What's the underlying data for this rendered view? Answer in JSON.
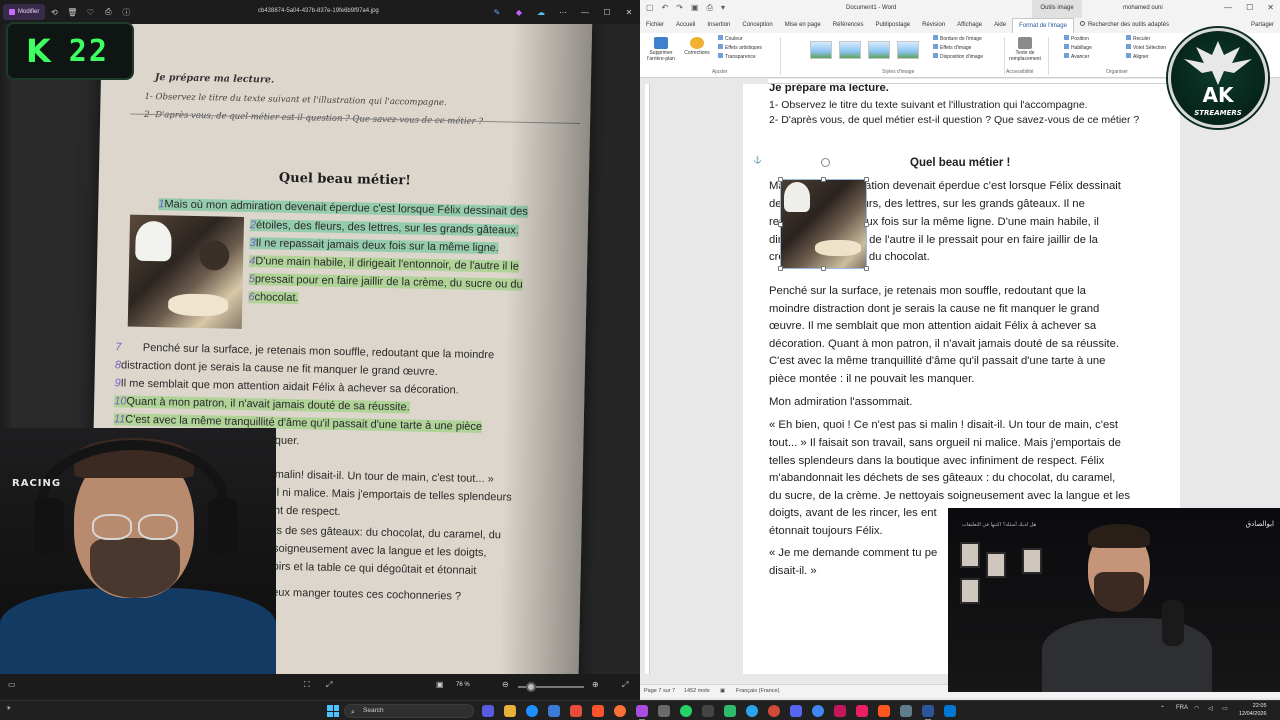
{
  "viewer": {
    "modifier_label": "Modifier",
    "file_name": "cb438874-5a04-437b-837e-19fe6b9f97a4.jpg",
    "zoom": "76 %"
  },
  "overlay": {
    "k_letter": "K",
    "k_number": "22"
  },
  "book_photo": {
    "prepare": "Je prépare ma lecture.",
    "q1": "1- Observez le titre du texte suivant et l'illustration qui l'accompagne.",
    "q2": "2- D'après vous, de quel métier est-il question ? Que savez-vous de ce métier ?",
    "title": "Quel beau métier!",
    "lines": [
      "Mais où mon admiration devenait éperdue c'est lorsque Félix dessinait des",
      "étoiles, des fleurs, des lettres, sur les grands gâteaux.",
      "Il ne repassait jamais deux fois sur la même ligne.",
      "D'une main habile, il dirigeait l'entonnoir, de l'autre il le",
      "pressait pour en faire jaillir de la crème, du sucre ou du",
      "chocolat.",
      "Penché sur la surface, je retenais mon souffle, redoutant que la moindre",
      "distraction dont je serais la cause ne fit manquer le grand œuvre.",
      "Il me semblait que mon attention aidait Félix à achever sa décoration.",
      "Quant à mon patron, il n'avait jamais douté de sa réussite.",
      "C'est avec la même tranquillité d'âme qu'il passait d'une tarte  à une pièce",
      "manquer.",
      "malin! disait-il. Un tour de main, c'est tout... »",
      "il ni malice. Mais j'emportais de telles splendeurs",
      "nt de respect.",
      "ts de ses gâteaux: du chocolat, du caramel, du",
      "soigneusement avec la langue et les doigts,",
      "oirs et la table ce qui dégoûtait et étonnait",
      "eux manger toutes ces cochonneries ?"
    ],
    "numbers": [
      "1",
      "2",
      "3",
      "4",
      "5",
      "6",
      "7",
      "8",
      "9",
      "10",
      "11"
    ]
  },
  "webcam_left": {
    "shirt_text": "RACING"
  },
  "word": {
    "doc_title": "Document1 - Word",
    "context_tab": "Outils image",
    "user": "mohamed ouni",
    "tabs": [
      "Fichier",
      "Accueil",
      "Insertion",
      "Conception",
      "Mise en page",
      "Références",
      "Publipostage",
      "Révision",
      "Affichage",
      "Aide",
      "Format de l'image",
      "Rechercher des outils adaptés",
      "Partager"
    ],
    "active_tab": "Format de l'image",
    "ribbon": {
      "remove_bg": "Supprimer l'arrière-plan",
      "corrections": "Corrections",
      "couleur": "Couleur",
      "effets_artistiques": "Effets artistiques",
      "transparence": "Transparence",
      "group_ajuster": "Ajuster",
      "group_styles": "Styles d'image",
      "bordure": "Bordure de l'image",
      "effets": "Effets d'image",
      "disposition": "Disposition d'image",
      "texte_rempl": "Texte de remplacement",
      "group_access": "Accessibilité",
      "position": "Position",
      "habillage": "Habillage",
      "avancer": "Avancer",
      "reculer": "Reculer",
      "volet": "Volet Sélection",
      "aligner": "Aligner",
      "group_organiser": "Organiser"
    },
    "page": {
      "prepare": "Je prépare ma lecture.",
      "q1": "1- Observez le titre du texte suivant et l'illustration qui l'accompagne.",
      "q2": "2- D'après vous, de quel métier est-il question ? Que savez-vous de ce métier ?",
      "title": "Quel beau métier !",
      "para1": [
        "Mais où mon admiration devenait éperdue c'est lorsque Félix dessinait",
        "des étoiles, des fleurs, des lettres, sur les grands gâteaux. Il ne",
        "repassait jamais deux fois sur la même ligne. D'une main habile, il",
        "dirigeait l'entonnoir, de l'autre il le pressait pour en faire jaillir de la",
        "crème, du sucre ou du chocolat."
      ],
      "para2": [
        "Penché sur la surface, je retenais mon souffle, redoutant que la",
        "moindre distraction dont je serais la cause ne fit manquer le grand",
        "œuvre. Il me semblait que mon attention aidait Félix à achever sa",
        "décoration. Quant à mon patron, il n'avait jamais douté de sa réussite.",
        "C'est avec la même tranquillité d'âme qu'il passait d'une tarte à une",
        "pièce montée : il ne pouvait les manquer."
      ],
      "para3": "Mon admiration l'assommait.",
      "para4": [
        "« Eh bien, quoi ! Ce n'est pas si malin ! disait-il. Un tour de main, c'est",
        "tout... » Il faisait son travail, sans orgueil ni malice. Mais j'emportais de",
        "telles splendeurs dans la boutique avec infiniment de respect. Félix",
        "m'abandonnait les déchets de ses gâteaux : du chocolat, du caramel,",
        "du sucre, de la crème. Je nettoyais soigneusement avec la langue et les",
        "doigts, avant de les rincer, les ent",
        "étonnait toujours Félix."
      ],
      "para5": [
        "« Je me demande comment tu pe",
        "disait-il. »"
      ]
    },
    "status": {
      "page": "Page 7 sur 7",
      "words": "1452 mots",
      "lang": "Français (France)"
    }
  },
  "logo": {
    "ak": "AK",
    "streamers": "STREAMERS"
  },
  "webcam_right": {
    "arabic_name": "ابوالصادق",
    "arabic_sub": "هل لديك أسئلة؟ اكتبها في التعليقات"
  },
  "taskbar": {
    "search": "Search",
    "lang": "FRA",
    "time": "22:05",
    "date": "12/04/2026"
  }
}
